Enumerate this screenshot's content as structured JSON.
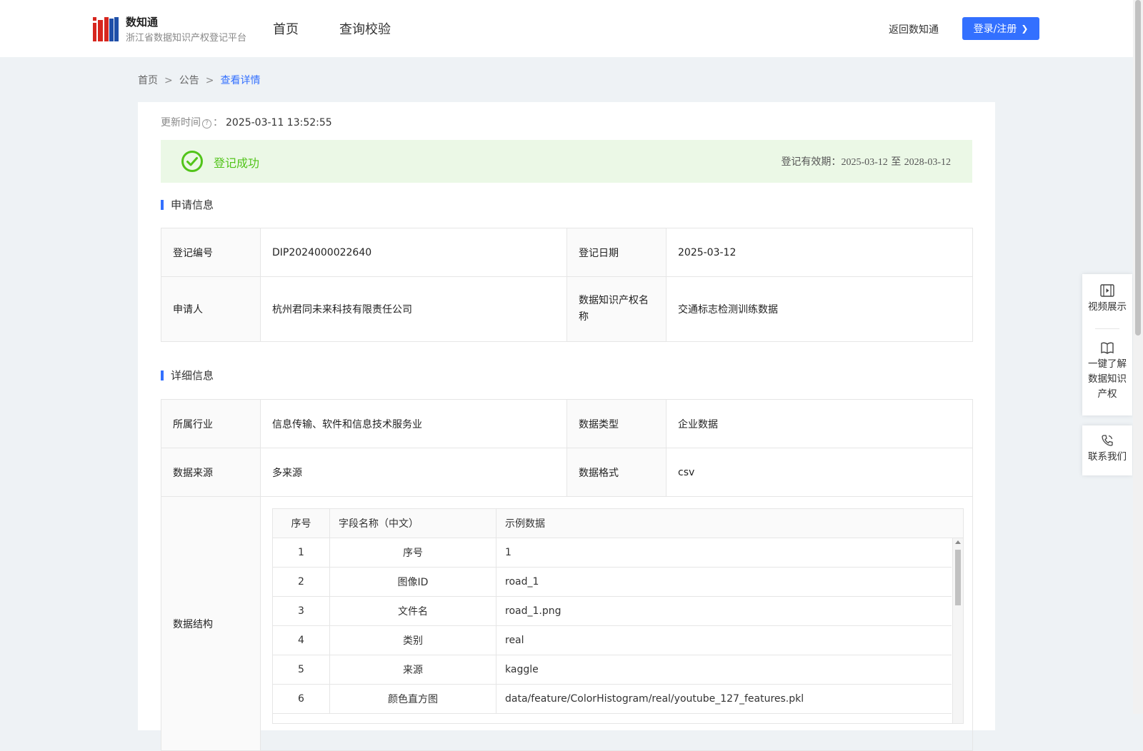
{
  "header": {
    "logo_title": "数知通",
    "logo_subtitle": "浙江省数据知识产权登记平台",
    "nav": [
      "首页",
      "查询校验"
    ],
    "back_link": "返回数知通",
    "login_button": "登录/注册"
  },
  "breadcrumb": [
    "首页",
    "公告",
    "查看详情"
  ],
  "update": {
    "label": "更新时间",
    "value": "2025-03-11 13:52:55"
  },
  "status": {
    "text": "登记成功",
    "validity_label": "登记有效期：",
    "validity_from": "2025-03-12",
    "validity_to_word": "至",
    "validity_to": "2028-03-12",
    "color": "#52c41a"
  },
  "application_info": {
    "title": "申请信息",
    "rows": [
      {
        "k1": "登记编号",
        "v1": "DIP2024000022640",
        "k2": "登记日期",
        "v2": "2025-03-12"
      },
      {
        "k1": "申请人",
        "v1": "杭州君同未来科技有限责任公司",
        "k2": "数据知识产权名称",
        "v2": "交通标志检测训练数据"
      }
    ]
  },
  "detail_info": {
    "title": "详细信息",
    "rows": [
      {
        "k1": "所属行业",
        "v1": "信息传输、软件和信息技术服务业",
        "k2": "数据类型",
        "v2": "企业数据"
      },
      {
        "k1": "数据来源",
        "v1": "多来源",
        "k2": "数据格式",
        "v2": "csv"
      }
    ],
    "structure_label": "数据结构",
    "structure_columns": [
      "序号",
      "字段名称（中文）",
      "示例数据"
    ],
    "structure_rows": [
      [
        "1",
        "序号",
        "1"
      ],
      [
        "2",
        "图像ID",
        "road_1"
      ],
      [
        "3",
        "文件名",
        "road_1.png"
      ],
      [
        "4",
        "类别",
        "real"
      ],
      [
        "5",
        "来源",
        "kaggle"
      ],
      [
        "6",
        "颜色直方图",
        "data/feature/ColorHistogram/real/youtube_127_features.pkl"
      ]
    ]
  },
  "side_panel": [
    "视频展示",
    "一键了解数据知识产权",
    "联系我们"
  ],
  "colors": {
    "accent": "#3370ff",
    "success_bg": "#ebf8e6"
  }
}
